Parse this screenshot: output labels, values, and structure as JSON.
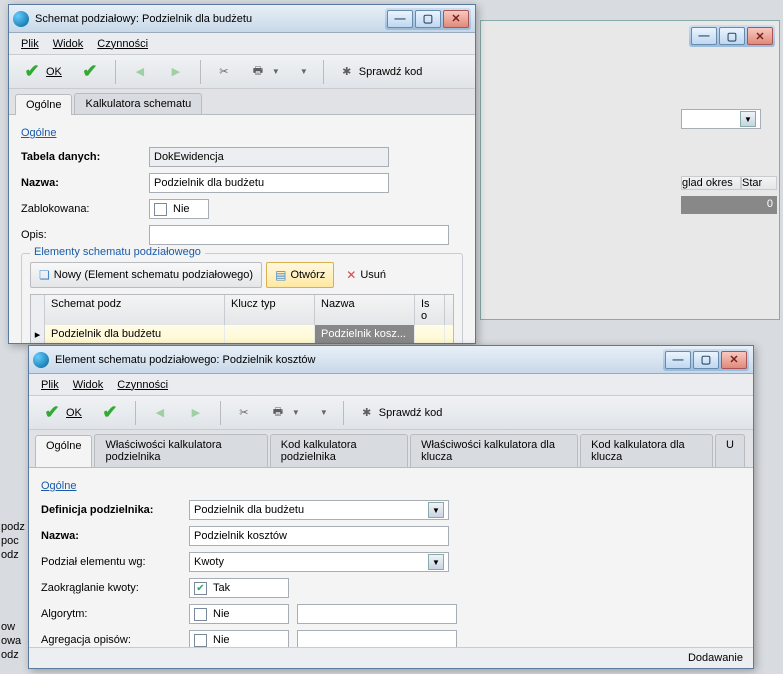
{
  "bg1": {
    "winbtns": {
      "min": "—",
      "max": "▢",
      "close": "✕"
    },
    "cols": {
      "okres": "glad okres",
      "star": "Star"
    },
    "val0": "0"
  },
  "bg2": {
    "side": [
      "podz",
      "poc",
      "odz"
    ],
    "bottom": [
      "ow",
      "owa",
      "odz"
    ]
  },
  "win1": {
    "title": "Schemat podziałowy: Podzielnik dla budżetu",
    "menu": {
      "plik": "Plik",
      "widok": "Widok",
      "czynnosci": "Czynności"
    },
    "toolbar": {
      "ok": "OK",
      "sprawdz": "Sprawdź kod"
    },
    "tabs": {
      "ogolne": "Ogólne",
      "kalk": "Kalkulatora schematu"
    },
    "section1": "Ogólne",
    "labels": {
      "tabela": "Tabela danych:",
      "nazwa": "Nazwa:",
      "zablokowana": "Zablokowana:",
      "opis": "Opis:"
    },
    "values": {
      "tabela": "DokEwidencja",
      "nazwa": "Podzielnik dla budżetu",
      "zablokowana": "Nie"
    },
    "section2": "Elementy schematu podziałowego",
    "actions": {
      "nowy": "Nowy (Element schematu podziałowego)",
      "otworz": "Otwórz",
      "usun": "Usuń"
    },
    "grid": {
      "cols": {
        "schemat": "Schemat podz",
        "klucz": "Klucz typ",
        "nazwa": "Nazwa",
        "iso": "Is o"
      },
      "row": {
        "schemat": "Podzielnik dla budżetu",
        "nazwa": "Podzielnik kosz..."
      }
    }
  },
  "win2": {
    "title": "Element schematu podziałowego: Podzielnik kosztów",
    "menu": {
      "plik": "Plik",
      "widok": "Widok",
      "czynnosci": "Czynności"
    },
    "toolbar": {
      "ok": "OK",
      "sprawdz": "Sprawdź kod"
    },
    "tabs": {
      "ogolne": "Ogólne",
      "wlasc_podz": "Właściwości kalkulatora podzielnika",
      "kod_podz": "Kod kalkulatora podzielnika",
      "wlasc_klucz": "Właściwości kalkulatora dla klucza",
      "kod_klucz": "Kod kalkulatora dla klucza",
      "u": "U"
    },
    "section": "Ogólne",
    "labels": {
      "definicja": "Definicja podzielnika:",
      "nazwa": "Nazwa:",
      "podzial": "Podział elementu wg:",
      "zaokr": "Zaokrąglanie kwoty:",
      "algorytm": "Algorytm:",
      "agregacja": "Agregacja opisów:"
    },
    "values": {
      "definicja": "Podzielnik dla budżetu",
      "nazwa": "Podzielnik kosztów",
      "podzial": "Kwoty",
      "zaokr": "Tak",
      "algorytm": "Nie",
      "agregacja": "Nie"
    },
    "status": "Dodawanie"
  }
}
